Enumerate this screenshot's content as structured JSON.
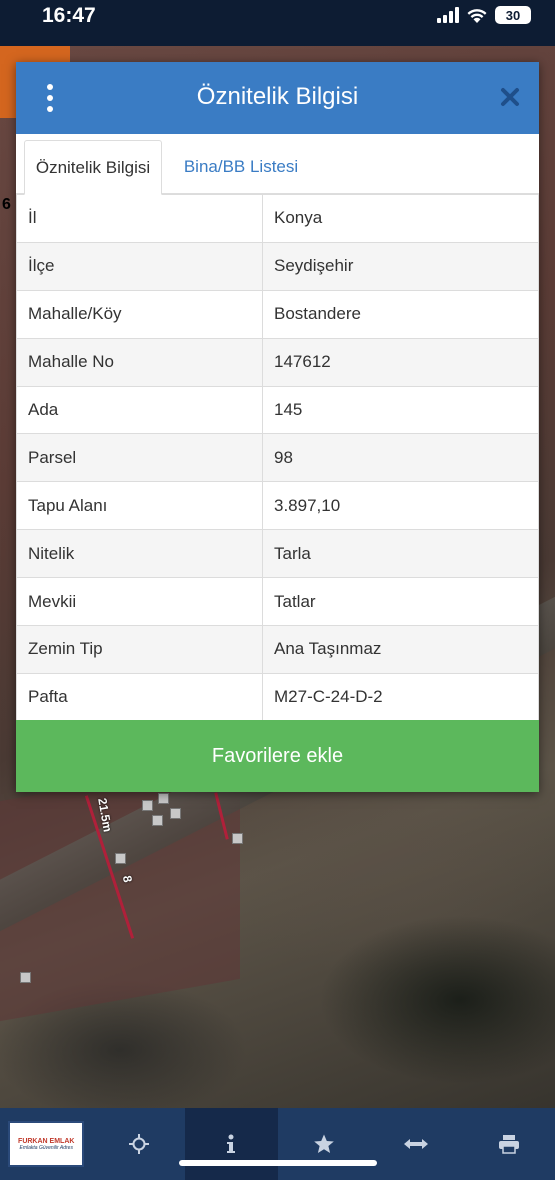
{
  "status_bar": {
    "time": "16:47",
    "battery": "30"
  },
  "dialog": {
    "title": "Öznitelik Bilgisi",
    "tabs": [
      {
        "label": "Öznitelik Bilgisi",
        "active": true
      },
      {
        "label": "Bina/BB Listesi",
        "active": false
      }
    ],
    "rows": [
      {
        "key": "İl",
        "value": "Konya"
      },
      {
        "key": "İlçe",
        "value": "Seydişehir"
      },
      {
        "key": "Mahalle/Köy",
        "value": "Bostandere"
      },
      {
        "key": "Mahalle No",
        "value": "147612"
      },
      {
        "key": "Ada",
        "value": "145"
      },
      {
        "key": "Parsel",
        "value": "98"
      },
      {
        "key": "Tapu Alanı",
        "value": "3.897,10"
      },
      {
        "key": "Nitelik",
        "value": "Tarla"
      },
      {
        "key": "Mevkii",
        "value": "Tatlar"
      },
      {
        "key": "Zemin Tip",
        "value": "Ana Taşınmaz"
      },
      {
        "key": "Pafta",
        "value": "M27-C-24-D-2"
      }
    ],
    "favorite_button": "Favorilere ekle"
  },
  "map_labels": {
    "edge_number": "6",
    "distance": "21.5m",
    "segment": "8"
  },
  "toolbar": {
    "logo_name": "FURKAN EMLAK",
    "logo_slogan": "Emlakta Güvenilir Adres",
    "items": [
      {
        "icon": "logo"
      },
      {
        "icon": "move-icon"
      },
      {
        "icon": "info-icon",
        "active": true
      },
      {
        "icon": "star-icon"
      },
      {
        "icon": "measure-icon"
      },
      {
        "icon": "print-icon"
      }
    ]
  },
  "colors": {
    "header": "#3a7cc4",
    "favorite_button": "#5cb85c",
    "toolbar": "#1f3b63"
  }
}
